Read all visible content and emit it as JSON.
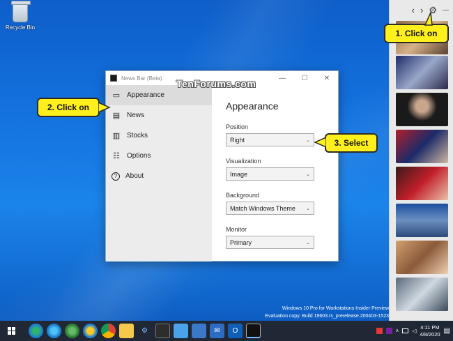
{
  "desktop": {
    "recycle_bin_label": "Recycle Bin",
    "watermark": "TenForums.com",
    "eval_line1": "Windows 10 Pro for Workstations Insider Preview",
    "eval_line2": "Evaluation copy. Build 19603.rs_prerelease.200403-1523"
  },
  "news_bar": {
    "prev_icon": "‹",
    "next_icon": "›",
    "settings_icon": "⚙",
    "minimize_icon": "—"
  },
  "window": {
    "title": "News Bar (Beta)",
    "controls": {
      "minimize": "—",
      "maximize": "☐",
      "close": "✕"
    },
    "sidebar": [
      {
        "label": "Appearance",
        "icon": "▭"
      },
      {
        "label": "News",
        "icon": "▤"
      },
      {
        "label": "Stocks",
        "icon": "▥"
      },
      {
        "label": "Options",
        "icon": "☷"
      },
      {
        "label": "About",
        "icon": "?"
      }
    ],
    "content": {
      "heading": "Appearance",
      "position_label": "Position",
      "position_value": "Right",
      "visualization_label": "Visualization",
      "visualization_value": "Image",
      "background_label": "Background",
      "background_value": "Match Windows Theme",
      "monitor_label": "Monitor",
      "monitor_value": "Primary"
    }
  },
  "callouts": {
    "step1": "1. Click on",
    "step2": "2. Click on",
    "step3": "3. Select"
  },
  "taskbar": {
    "time": "4:11 PM",
    "date": "4/8/2020"
  },
  "colors": {
    "callout_fill": "#ffef1c",
    "taskbar": "#202836"
  }
}
